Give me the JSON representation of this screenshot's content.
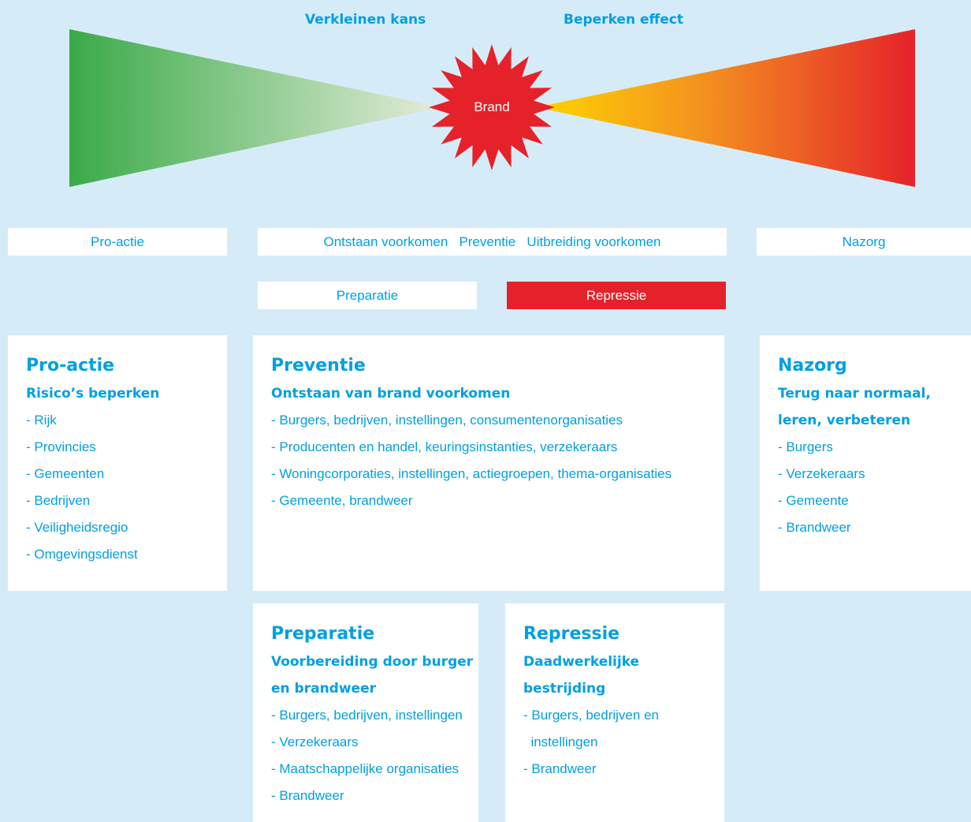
{
  "top_labels": {
    "left": "Verkleinen kans",
    "right": "Beperken effect"
  },
  "center": {
    "label": "Brand"
  },
  "colors": {
    "background": "#d5ecf8",
    "accent": "#009fe3",
    "green": "#3aaa48",
    "fade": "#e4ecd9",
    "yellow": "#ffd500",
    "orange": "#f39020",
    "red": "#e5222a"
  },
  "phases": {
    "proactie": "Pro-actie",
    "preventie_row": "Ontstaan voorkomen   Preventie   Uitbreiding voorkomen",
    "nazorg": "Nazorg",
    "preparatie": "Preparatie",
    "repressie": "Repressie"
  },
  "cards": {
    "proactie": {
      "title": "Pro-actie",
      "subtitle_lines": [
        "Risico’s beperken"
      ],
      "items": [
        "- Rijk",
        "- Provincies",
        "- Gemeenten",
        "- Bedrijven",
        "- Veiligheidsregio",
        "- Omgevingsdienst"
      ]
    },
    "preventie": {
      "title": "Preventie",
      "subtitle_lines": [
        "Ontstaan van brand voorkomen"
      ],
      "items": [
        "- Burgers, bedrijven, instellingen, consumentenorganisaties",
        "- Producenten en handel, keuringsinstanties, verzekeraars",
        "- Woningcorporaties, instellingen, actiegroepen, thema-organisaties",
        "- Gemeente, brandweer"
      ]
    },
    "nazorg": {
      "title": "Nazorg",
      "subtitle_lines": [
        "Terug naar normaal,",
        "leren, verbeteren"
      ],
      "items": [
        "- Burgers",
        "- Verzekeraars",
        "- Gemeente",
        "- Brandweer"
      ]
    },
    "preparatie": {
      "title": "Preparatie",
      "subtitle_lines": [
        "Voorbereiding door burger",
        "en brandweer"
      ],
      "items": [
        "- Burgers, bedrijven, instellingen",
        "- Verzekeraars",
        "- Maatschappelijke organisaties",
        "- Brandweer"
      ]
    },
    "repressie": {
      "title": "Repressie",
      "subtitle_lines": [
        "Daadwerkelijke",
        "bestrijding"
      ],
      "items": [
        "- Burgers, bedrijven en",
        "  instellingen",
        "- Brandweer"
      ]
    }
  }
}
